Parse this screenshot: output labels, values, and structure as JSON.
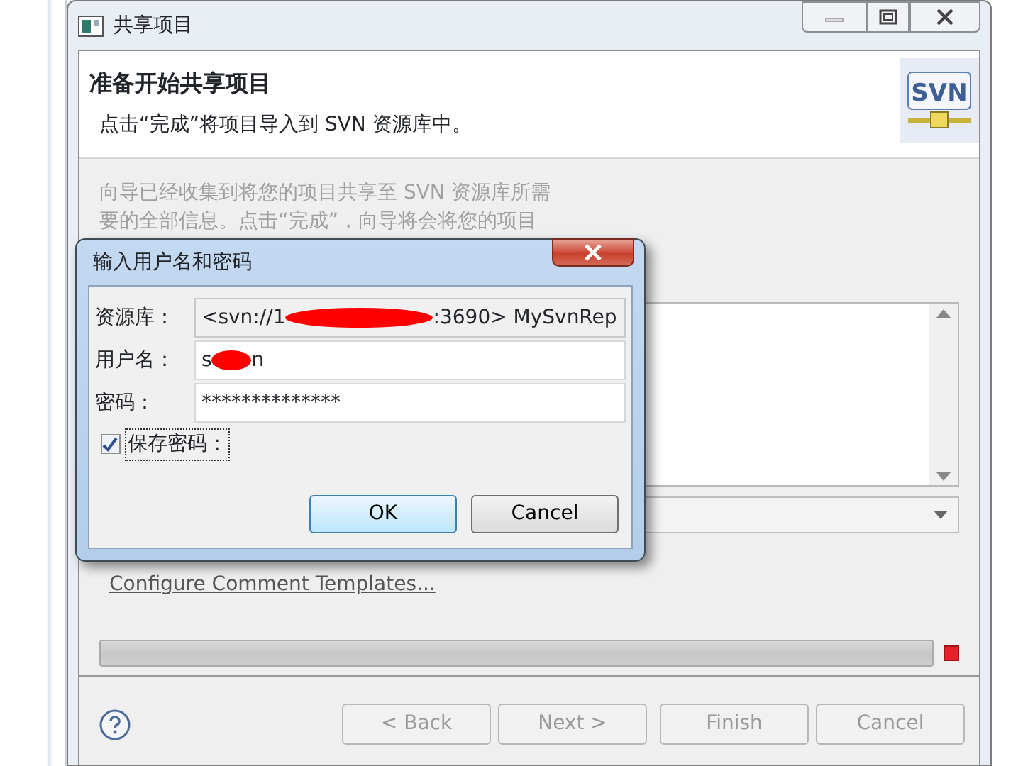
{
  "window": {
    "title": "共享项目"
  },
  "header": {
    "title": "准备开始共享项目",
    "description": "点击“完成”将项目导入到 SVN 资源库中。"
  },
  "intro": [
    "向导已经收集到将您的项目共享至 SVN 资源库所需",
    "要的全部信息。点击“完成”，向导将会将您的项目"
  ],
  "logo_text": "SVN",
  "link": "Configure Comment Templates...",
  "progress": {
    "level": 1
  },
  "buttons": [
    {
      "label": "< Back",
      "disabled": true
    },
    {
      "label": "Next >",
      "disabled": true
    },
    {
      "label": "Finish",
      "disabled": true
    },
    {
      "label": "Cancel",
      "disabled": true
    }
  ],
  "dialog": {
    "title": "输入用户名和密码",
    "fields": [
      {
        "label": "资源库：",
        "prefix": "<svn://1",
        "suffix": ":3690> MySvnRep",
        "readonly": true
      },
      {
        "label": "用户名：",
        "prefix": "s",
        "suffix": "n",
        "readonly": false
      },
      {
        "label": "密码：",
        "value": "**************",
        "readonly": false
      }
    ],
    "save_password": {
      "label": "保存密码：",
      "checked": true
    },
    "buttons": [
      {
        "label": "OK",
        "selected": true
      },
      {
        "label": "Cancel",
        "selected": false
      }
    ]
  }
}
